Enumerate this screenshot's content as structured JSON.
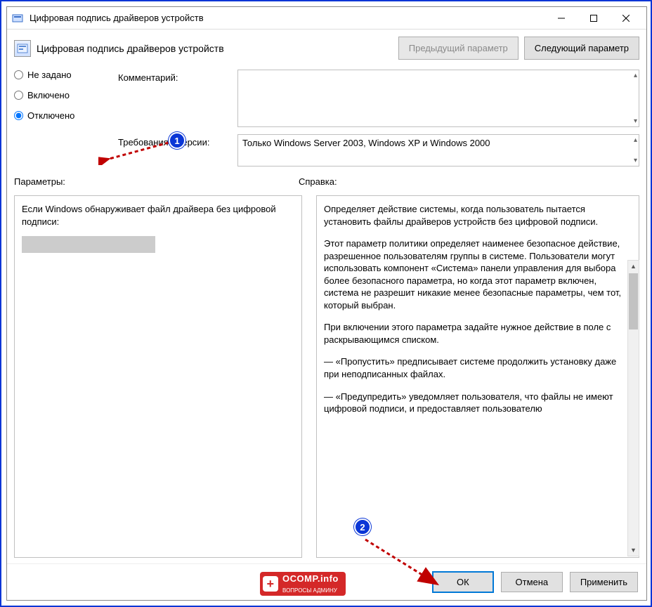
{
  "titlebar": {
    "title": "Цифровая подпись драйверов устройств"
  },
  "header": {
    "title": "Цифровая подпись драйверов устройств",
    "prev_btn": "Предыдущий параметр",
    "next_btn": "Следующий параметр"
  },
  "radios": {
    "not_configured": "Не задано",
    "enabled": "Включено",
    "disabled": "Отключено",
    "selected": "disabled"
  },
  "fields": {
    "comment_label": "Комментарий:",
    "comment_value": "",
    "supported_label": "Требования к версии:",
    "supported_value": "Только Windows Server 2003, Windows XP и Windows 2000"
  },
  "middle": {
    "options_label": "Параметры:",
    "help_label": "Справка:"
  },
  "options": {
    "text": "Если Windows обнаруживает файл драйвера без цифровой подписи:"
  },
  "help": {
    "p1": "Определяет действие системы, когда пользователь пытается установить файлы драйверов устройств без цифровой подписи.",
    "p2": "Этот параметр политики определяет наименее безопасное действие, разрешенное пользователям группы в системе. Пользователи могут использовать компонент «Система» панели управления для выбора более безопасного параметра, но когда этот параметр включен, система не разрешит никакие менее безопасные параметры, чем тот, который выбран.",
    "p3": "При включении этого параметра задайте нужное действие в поле с раскрывающимся списком.",
    "p4": "— «Пропустить» предписывает системе продолжить установку даже при неподписанных файлах.",
    "p5": "— «Предупредить» уведомляет пользователя, что файлы не имеют цифровой подписи, и предоставляет пользователю"
  },
  "footer": {
    "ok": "ОК",
    "cancel": "Отмена",
    "apply": "Применить"
  },
  "watermark": {
    "main": "OCOMP.info",
    "sub": "ВОПРОСЫ АДМИНУ"
  },
  "badges": {
    "one": "1",
    "two": "2"
  }
}
